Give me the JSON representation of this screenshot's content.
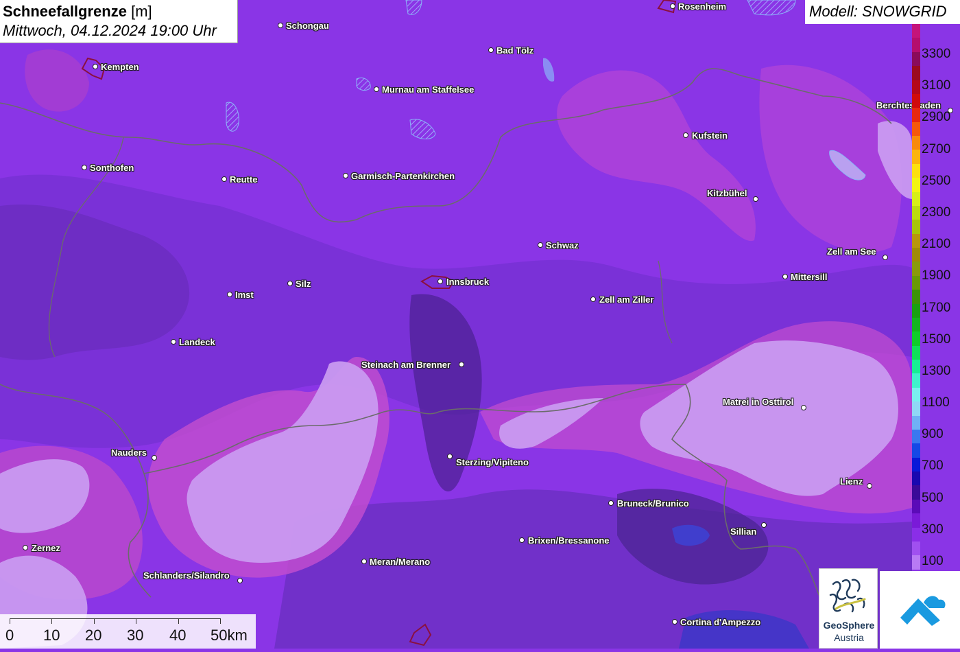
{
  "title": {
    "main": "Schneefallgrenze",
    "unit": "[m]",
    "datetime": "Mittwoch, 04.12.2024 19:00 Uhr"
  },
  "model": "Modell: SNOWGRID",
  "legend": {
    "labels": [
      "3300",
      "3100",
      "2900",
      "2700",
      "2500",
      "2300",
      "2100",
      "1900",
      "1700",
      "1500",
      "1300",
      "1100",
      "900",
      "700",
      "500",
      "300",
      "100"
    ],
    "colors_top_to_bottom": [
      "#c4147a",
      "#b40e6e",
      "#8a0b5a",
      "#9b0a1e",
      "#b5071a",
      "#d00b0b",
      "#e8280f",
      "#f5580c",
      "#f88a0c",
      "#fbb410",
      "#fde010",
      "#f2f512",
      "#d7ef18",
      "#bcdb10",
      "#a8c40a",
      "#b8960e",
      "#a08a08",
      "#8a9a0c",
      "#6a9a06",
      "#3c9208",
      "#1aa011",
      "#14b520",
      "#10cc2a",
      "#10e05a",
      "#18ee94",
      "#40f2cc",
      "#7af0f0",
      "#90d8f6",
      "#70b0f6",
      "#3a78f0",
      "#1648e6",
      "#0a18d8",
      "#1a08b0",
      "#3a0a98",
      "#5b0bb8",
      "#7a1ad8",
      "#8a2ee8",
      "#a050f0",
      "#b87af4"
    ]
  },
  "cities": [
    {
      "name": "Rosenheim"
    },
    {
      "name": "Schongau"
    },
    {
      "name": "Bad Tölz"
    },
    {
      "name": "Kempten"
    },
    {
      "name": "Murnau am Staffelsee"
    },
    {
      "name": "Berchtesgaden"
    },
    {
      "name": "Kufstein"
    },
    {
      "name": "Sonthofen"
    },
    {
      "name": "Reutte"
    },
    {
      "name": "Garmisch-Partenkirchen"
    },
    {
      "name": "Kitzbühel"
    },
    {
      "name": "Schwaz"
    },
    {
      "name": "Zell am See"
    },
    {
      "name": "Mittersill"
    },
    {
      "name": "Imst"
    },
    {
      "name": "Silz"
    },
    {
      "name": "Innsbruck"
    },
    {
      "name": "Zell am Ziller"
    },
    {
      "name": "Landeck"
    },
    {
      "name": "Steinach am Brenner"
    },
    {
      "name": "Matrei in Osttirol"
    },
    {
      "name": "Nauders"
    },
    {
      "name": "Sterzing/Vipiteno"
    },
    {
      "name": "Lienz"
    },
    {
      "name": "Bruneck/Brunico"
    },
    {
      "name": "Sillian"
    },
    {
      "name": "Brixen/Bressanone"
    },
    {
      "name": "Zernez"
    },
    {
      "name": "Meran/Merano"
    },
    {
      "name": "Schlanders/Silandro"
    },
    {
      "name": "Cortina d'Ampezzo"
    }
  ],
  "scale": {
    "labels": [
      "0",
      "10",
      "20",
      "30",
      "40",
      "50km"
    ]
  },
  "logos": {
    "geosphere_line1": "GeoSphere",
    "geosphere_line2": "Austria"
  },
  "colors": {
    "base": "#8a35e6",
    "dark": "#6a2fc2",
    "light": "#c596ee",
    "pink": "#c64ad4",
    "border": "#6b6b6b",
    "lake": "#8ab4f8"
  }
}
